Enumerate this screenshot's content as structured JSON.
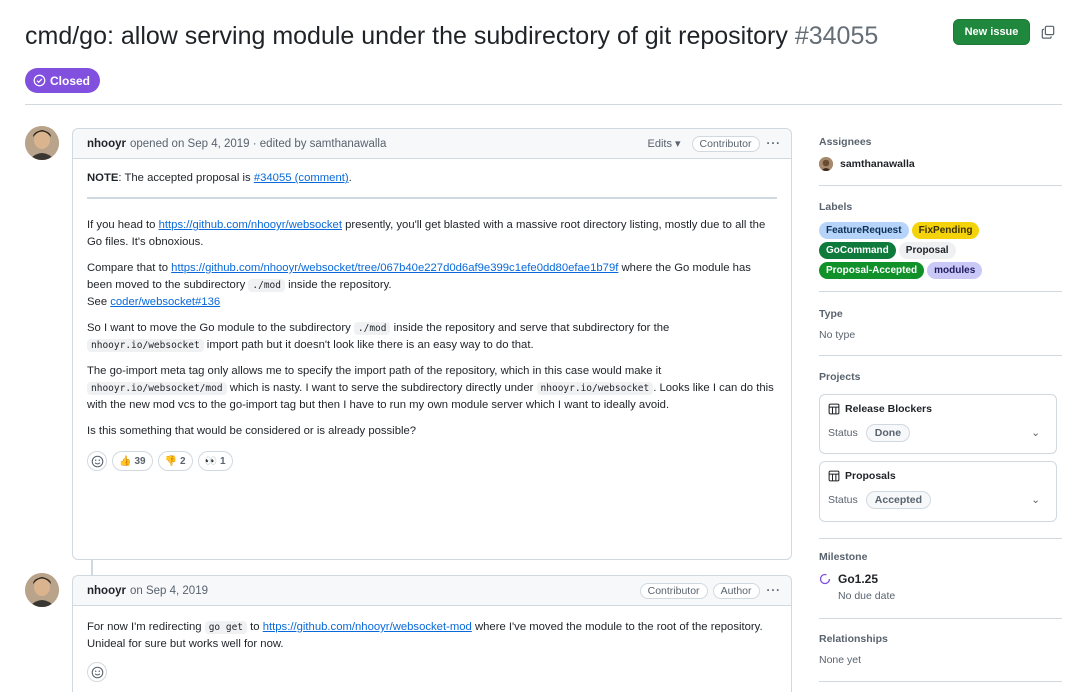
{
  "issue": {
    "title": "cmd/go: allow serving module under the subdirectory of git repository",
    "number": "#34055",
    "state": "Closed",
    "new_issue_label": "New issue"
  },
  "comments": [
    {
      "author": "nhooyr",
      "meta": "opened on Sep 4, 2019 · edited by samthanawalla",
      "edits_label": "Edits",
      "badges": [
        "Contributor"
      ],
      "note_strong": "NOTE",
      "note_text": ": The accepted proposal is ",
      "note_link": "#34055 (comment)",
      "note_end": ".",
      "p1_pre": "If you head to ",
      "p1_link": "https://github.com/nhooyr/websocket",
      "p1_post": " presently, you'll get blasted with a massive root directory listing, mostly due to all the Go files. It's obnoxious.",
      "p2_pre": "Compare that to ",
      "p2_link": "https://github.com/nhooyr/websocket/tree/067b40e227d0d6af9e399c1efe0dd80efae1b79f",
      "p2_mid": " where the Go module has been moved to the subdirectory ",
      "p2_code": "./mod",
      "p2_post": " inside the repository.",
      "p2_see": "See ",
      "p2_see_link": "coder/websocket#136",
      "p3_pre": "So I want to move the Go module to the subdirectory ",
      "p3_code1": "./mod",
      "p3_mid": " inside the repository and serve that subdirectory for the ",
      "p3_code2": "nhooyr.io/websocket",
      "p3_post": " import path but it doesn't look like there is an easy way to do that.",
      "p4_pre": "The go-import meta tag only allows me to specify the import path of the repository, which in this case would make it ",
      "p4_code1": "nhooyr.io/websocket/mod",
      "p4_mid": " which is nasty. I want to serve the subdirectory directly under ",
      "p4_code2": "nhooyr.io/websocket",
      "p4_post": ". Looks like I can do this with the new mod vcs to the go-import tag but then I have to run my own module server which I want to ideally avoid.",
      "p5": "Is this something that would be considered or is already possible?",
      "reactions": [
        {
          "emoji": "👍",
          "count": "39"
        },
        {
          "emoji": "👎",
          "count": "2"
        },
        {
          "emoji": "👀",
          "count": "1"
        }
      ]
    },
    {
      "author": "nhooyr",
      "meta": "on Sep 4, 2019",
      "badges": [
        "Contributor",
        "Author"
      ],
      "p1_pre": "For now I'm redirecting ",
      "p1_code": "go get",
      "p1_mid": " to ",
      "p1_link": "https://github.com/nhooyr/websocket-mod",
      "p1_post": " where I've moved the module to the root of the repository. Unideal for sure but works well for now."
    }
  ],
  "sidebar": {
    "assignees_heading": "Assignees",
    "assignee": "samthanawalla",
    "labels_heading": "Labels",
    "labels": [
      {
        "name": "FeatureRequest",
        "bg": "#b6d4f9",
        "fg": "#0b2f55"
      },
      {
        "name": "FixPending",
        "bg": "#f5d30a",
        "fg": "#3a2f00"
      },
      {
        "name": "GoCommand",
        "bg": "#0e7a3c",
        "fg": "#ffffff"
      },
      {
        "name": "Proposal",
        "bg": "#eef0f2",
        "fg": "#1f2328"
      },
      {
        "name": "Proposal-Accepted",
        "bg": "#10912a",
        "fg": "#ffffff"
      },
      {
        "name": "modules",
        "bg": "#c9c8f7",
        "fg": "#1f1c5e"
      }
    ],
    "type_heading": "Type",
    "type_value": "No type",
    "projects_heading": "Projects",
    "projects": [
      {
        "name": "Release Blockers",
        "status_label": "Status",
        "status": "Done"
      },
      {
        "name": "Proposals",
        "status_label": "Status",
        "status": "Accepted"
      }
    ],
    "milestone_heading": "Milestone",
    "milestone": "Go1.25",
    "milestone_due": "No due date",
    "relationships_heading": "Relationships",
    "relationships_value": "None yet"
  },
  "colors": {
    "closed": "#8250df",
    "primary_button": "#1f883d",
    "link": "#0969da"
  }
}
